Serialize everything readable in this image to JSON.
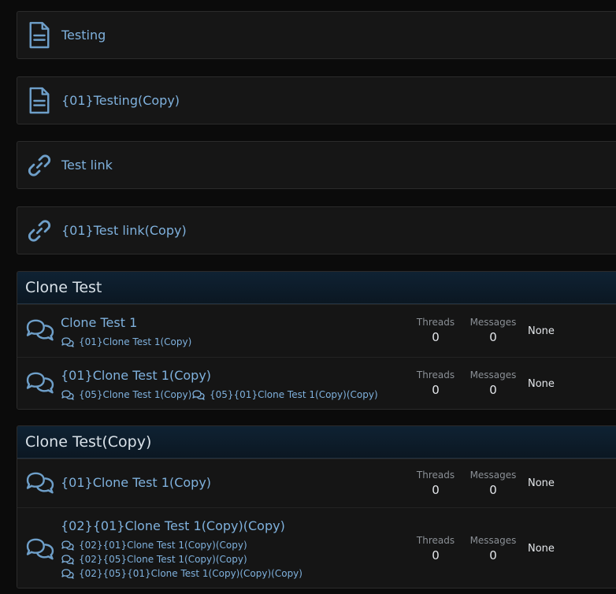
{
  "nodes": [
    {
      "title": "Testing",
      "icon": "document-icon"
    },
    {
      "title": "{01}Testing(Copy)",
      "icon": "document-icon"
    },
    {
      "title": "Test link",
      "icon": "link-icon"
    },
    {
      "title": "{01}Test link(Copy)",
      "icon": "link-icon"
    }
  ],
  "categories": [
    {
      "title": "Clone Test",
      "forums": [
        {
          "title": "Clone Test 1",
          "subforums": [
            "{01}Clone Test 1(Copy)"
          ],
          "threads_label": "Threads",
          "threads": "0",
          "messages_label": "Messages",
          "messages": "0",
          "last_post": "None"
        },
        {
          "title": "{01}Clone Test 1(Copy)",
          "subforums": [
            "{05}Clone Test 1(Copy)",
            "{05}{01}Clone Test 1(Copy)(Copy)"
          ],
          "threads_label": "Threads",
          "threads": "0",
          "messages_label": "Messages",
          "messages": "0",
          "last_post": "None"
        }
      ]
    },
    {
      "title": "Clone Test(Copy)",
      "forums": [
        {
          "title": "{01}Clone Test 1(Copy)",
          "subforums": [],
          "threads_label": "Threads",
          "threads": "0",
          "messages_label": "Messages",
          "messages": "0",
          "last_post": "None"
        },
        {
          "title": "{02}{01}Clone Test 1(Copy)(Copy)",
          "subforums": [
            "{02}{01}Clone Test 1(Copy)(Copy)",
            "{02}{05}Clone Test 1(Copy)(Copy)",
            "{02}{05}{01}Clone Test 1(Copy)(Copy)(Copy)"
          ],
          "threads_label": "Threads",
          "threads": "0",
          "messages_label": "Messages",
          "messages": "0",
          "last_post": "None"
        }
      ]
    }
  ],
  "colors": {
    "link": "#7fb1dd",
    "icon": "#6e9fc9",
    "header_bg": "#0f2233"
  }
}
